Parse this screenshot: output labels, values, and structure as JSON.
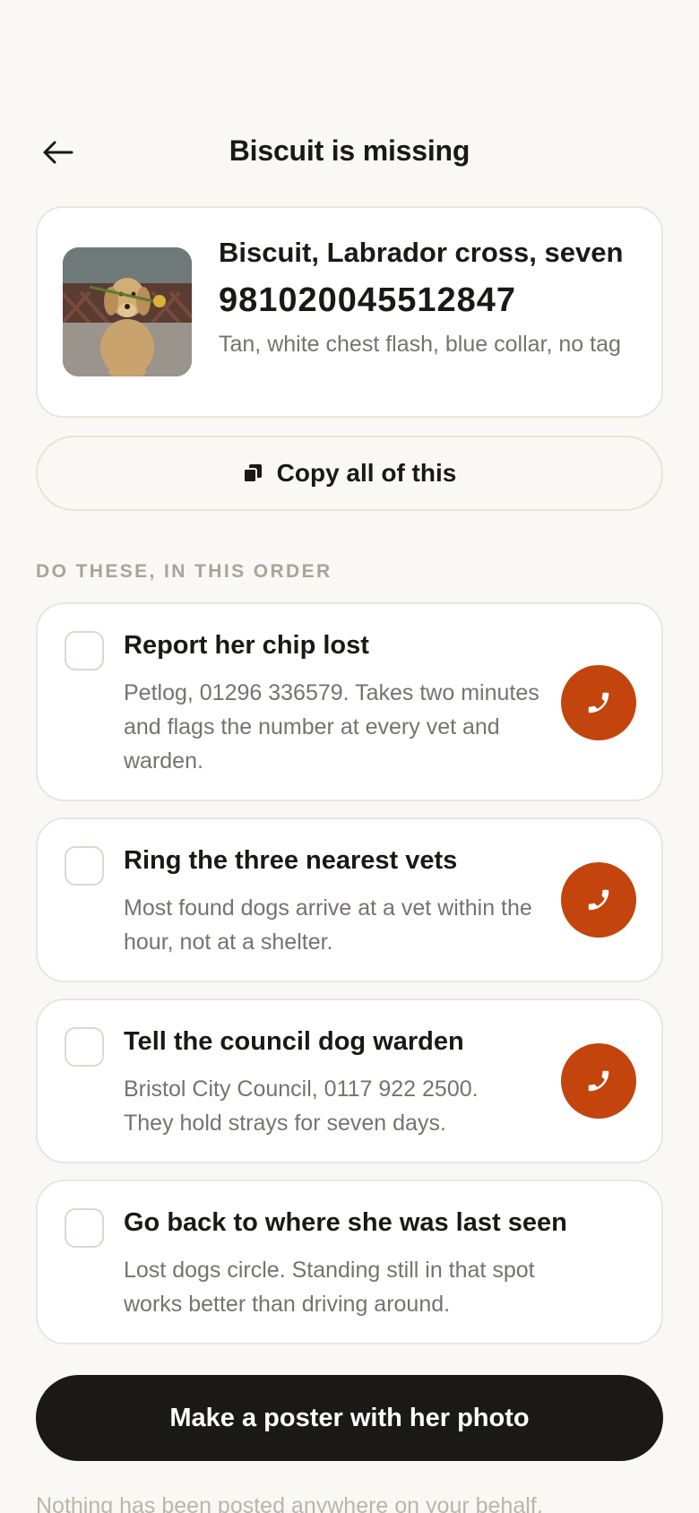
{
  "header": {
    "title": "Biscuit is missing",
    "back_icon": "arrow-left-icon"
  },
  "dog": {
    "name_line": "Biscuit, Labrador cross, seven",
    "chip_number": "981020045512847",
    "description": "Tan, white chest flash, blue collar, no tag"
  },
  "copy_button": {
    "icon": "copy-icon",
    "label": "Copy all of this"
  },
  "section_label": "DO THESE, IN THIS ORDER",
  "tasks": [
    {
      "title": "Report her chip lost",
      "description": "Petlog, 01296 336579. Takes two minutes and flags the number at every vet and warden.",
      "checked": false,
      "has_call": true
    },
    {
      "title": "Ring the three nearest vets",
      "description": "Most found dogs arrive at a vet within the hour, not at a shelter.",
      "checked": false,
      "has_call": true
    },
    {
      "title": "Tell the council dog warden",
      "description": "Bristol City Council, 0117 922 2500. They hold strays for seven days.",
      "checked": false,
      "has_call": true
    },
    {
      "title": "Go back to where she was last seen",
      "description": "Lost dogs circle. Standing still in that spot works better than driving around.",
      "checked": false,
      "has_call": false
    }
  ],
  "poster_button": {
    "label": "Make a poster with her photo"
  },
  "footer_note": "Nothing has been posted anywhere on your behalf.",
  "colors": {
    "accent": "#c4440d",
    "background": "#f9f8f5",
    "dark": "#1b1915",
    "muted_text": "#77736c"
  }
}
